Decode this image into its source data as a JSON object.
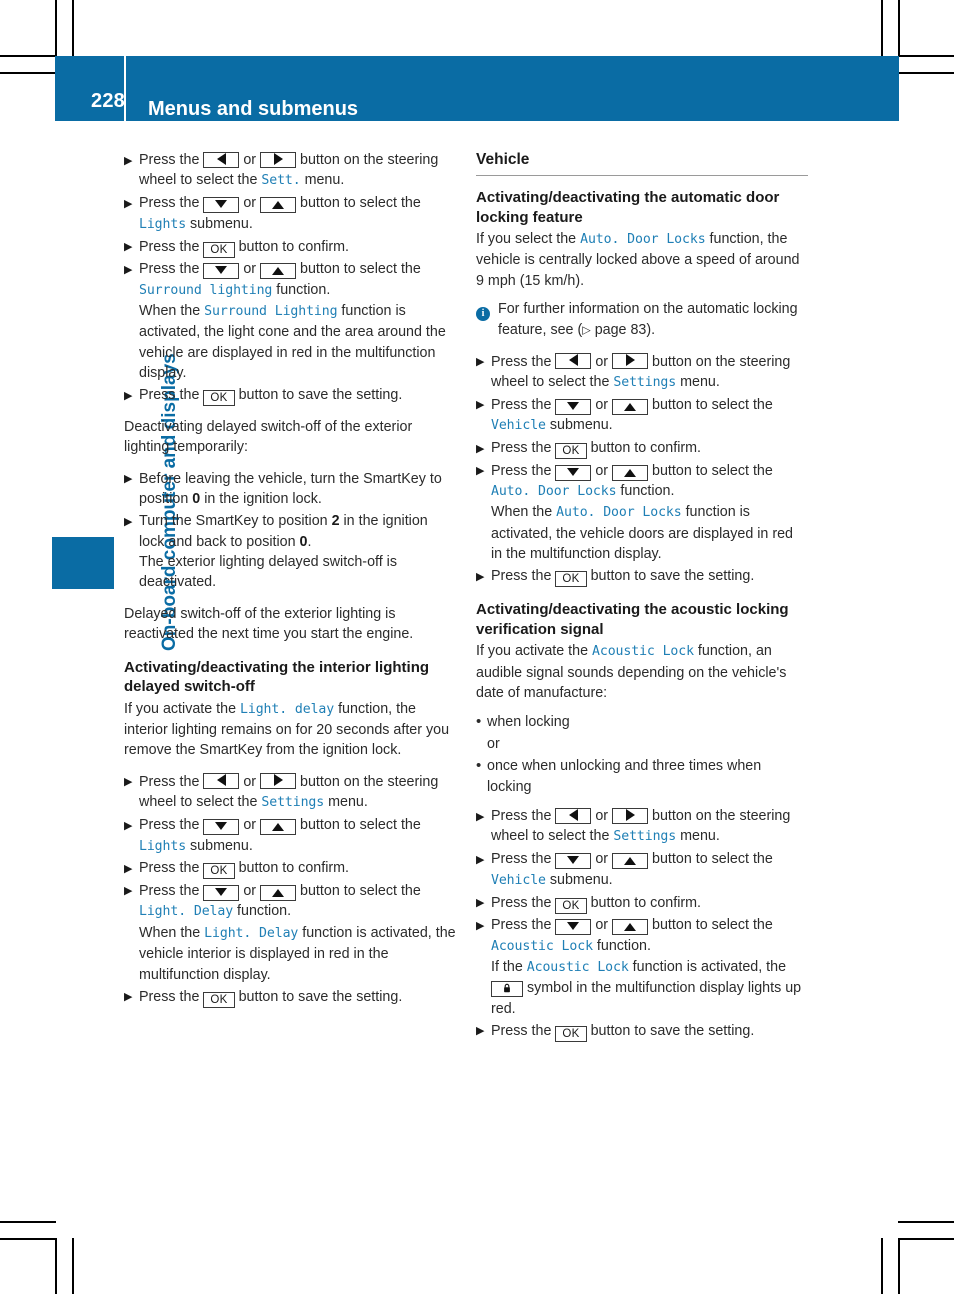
{
  "header": {
    "page_number": "228",
    "title": "Menus and submenus"
  },
  "sidebar": {
    "chapter_label": "On-board computer and displays"
  },
  "left_column": {
    "steps_surround": [
      {
        "id": "s1",
        "text_a": "Press the ",
        "key1": "left-arrow",
        "or": " or ",
        "key2": "right-arrow",
        "text_b": " button on the steering wheel to select the ",
        "mono": "Sett.",
        "text_c": " menu."
      },
      {
        "id": "s2",
        "text_a": "Press the ",
        "key1": "down-arrow",
        "or": " or ",
        "key2": "up-arrow",
        "text_b": " button to select the ",
        "mono": "Lights",
        "text_c": " submenu."
      },
      {
        "id": "s3",
        "text_a": "Press the ",
        "key1": "OK",
        "text_b": " button to confirm."
      },
      {
        "id": "s4",
        "text_a": "Press the ",
        "key1": "down-arrow",
        "or": " or ",
        "key2": "up-arrow",
        "text_b": " button to select the ",
        "mono": "Surround lighting",
        "text_c": " function.",
        "follow_a": "When the ",
        "follow_mono": "Surround Lighting",
        "follow_b": " function is activated, the light cone and the area around the vehicle are displayed in red in the multifunction display."
      },
      {
        "id": "s5",
        "text_a": "Press the ",
        "key1": "OK",
        "text_b": " button to save the setting."
      }
    ],
    "deactivating_intro": "Deactivating delayed switch-off of the exterior lighting temporarily:",
    "steps_deactivate": [
      {
        "id": "d1",
        "text_a": "Before leaving the vehicle, turn the SmartKey to position ",
        "bold": "0",
        "text_b": " in the ignition lock."
      },
      {
        "id": "d2",
        "text_a": "Turn the SmartKey to position ",
        "bold": "2",
        "text_b": " in the ignition lock and back to position ",
        "bold2": "0",
        "text_c": ".",
        "follow": "The exterior lighting delayed switch-off is deactivated."
      }
    ],
    "reactivate_note": "Delayed switch-off of the exterior lighting is reactivated the next time you start the engine.",
    "interior_heading": "Activating/deactivating the interior lighting delayed switch-off",
    "interior_intro_a": "If you activate the ",
    "interior_intro_mono": "Light. delay",
    "interior_intro_b": " function, the interior lighting remains on for 20 seconds after you remove the SmartKey from the ignition lock.",
    "steps_interior": [
      {
        "id": "i1",
        "text_a": "Press the ",
        "key1": "left-arrow",
        "or": " or ",
        "key2": "right-arrow",
        "text_b": " button on the steering wheel to select the ",
        "mono": "Settings",
        "text_c": " menu."
      },
      {
        "id": "i2",
        "text_a": "Press the ",
        "key1": "down-arrow",
        "or": " or ",
        "key2": "up-arrow",
        "text_b": " button to select the ",
        "mono": "Lights",
        "text_c": " submenu."
      },
      {
        "id": "i3",
        "text_a": "Press the ",
        "key1": "OK",
        "text_b": " button to confirm."
      },
      {
        "id": "i4",
        "text_a": "Press the ",
        "key1": "down-arrow",
        "or": " or ",
        "key2": "up-arrow",
        "text_b": " button to select the ",
        "mono": "Light. Delay",
        "text_c": " function.",
        "follow_a": "When the ",
        "follow_mono": "Light. Delay",
        "follow_b": " function is activated, the vehicle interior is displayed in red in the multifunction display."
      },
      {
        "id": "i5",
        "text_a": "Press the ",
        "key1": "OK",
        "text_b": " button to save the setting."
      }
    ]
  },
  "right_column": {
    "section_heading": "Vehicle",
    "auto_door_heading": "Activating/deactivating the automatic door locking feature",
    "auto_door_intro_a": "If you select the ",
    "auto_door_intro_mono": "Auto. Door Locks",
    "auto_door_intro_b": " function, the vehicle is centrally locked above a speed of around 9 mph (15 km/h).",
    "note_icon": "info-icon",
    "note_text_a": "For further information on the automatic locking feature, see (",
    "note_page_arrow": "▷",
    "note_text_b": " page 83).",
    "steps_auto_door": [
      {
        "id": "a1",
        "text_a": "Press the ",
        "key1": "left-arrow",
        "or": " or ",
        "key2": "right-arrow",
        "text_b": " button on the steering wheel to select the ",
        "mono": "Settings",
        "text_c": " menu."
      },
      {
        "id": "a2",
        "text_a": "Press the ",
        "key1": "down-arrow",
        "or": " or ",
        "key2": "up-arrow",
        "text_b": " button to select the ",
        "mono": "Vehicle",
        "text_c": " submenu."
      },
      {
        "id": "a3",
        "text_a": "Press the ",
        "key1": "OK",
        "text_b": " button to confirm."
      },
      {
        "id": "a4",
        "text_a": "Press the ",
        "key1": "down-arrow",
        "or": " or ",
        "key2": "up-arrow",
        "text_b": " button to select the ",
        "mono": "Auto. Door Locks",
        "text_c": " function.",
        "follow_a": "When the ",
        "follow_mono": "Auto. Door Locks",
        "follow_b": " function is activated, the vehicle doors are displayed in red in the multifunction display."
      },
      {
        "id": "a5",
        "text_a": "Press the ",
        "key1": "OK",
        "text_b": " button to save the setting."
      }
    ],
    "acoustic_heading": "Activating/deactivating the acoustic locking verification signal",
    "acoustic_intro_a": "If you activate the ",
    "acoustic_intro_mono": "Acoustic Lock",
    "acoustic_intro_b": " function, an audible signal sounds depending on the vehicle's date of manufacture:",
    "acoustic_bullets": [
      "when locking",
      "or",
      "once when unlocking and three times when locking"
    ],
    "steps_acoustic": [
      {
        "id": "c1",
        "text_a": "Press the ",
        "key1": "left-arrow",
        "or": " or ",
        "key2": "right-arrow",
        "text_b": " button on the steering wheel to select the ",
        "mono": "Settings",
        "text_c": " menu."
      },
      {
        "id": "c2",
        "text_a": "Press the ",
        "key1": "down-arrow",
        "or": " or ",
        "key2": "up-arrow",
        "text_b": " button to select the ",
        "mono": "Vehicle",
        "text_c": " submenu."
      },
      {
        "id": "c3",
        "text_a": "Press the ",
        "key1": "OK",
        "text_b": " button to confirm."
      },
      {
        "id": "c4",
        "text_a": "Press the ",
        "key1": "down-arrow",
        "or": " or ",
        "key2": "up-arrow",
        "text_b": " button to select the ",
        "mono": "Acoustic Lock",
        "text_c": " function.",
        "follow_a": "If the ",
        "follow_mono": "Acoustic Lock",
        "follow_b": " function is activated, the ",
        "follow_key": "padlock-symbol",
        "follow_c": " symbol in the multifunction display lights up red."
      },
      {
        "id": "c5",
        "text_a": "Press the ",
        "key1": "OK",
        "text_b": " button to save the setting."
      }
    ]
  },
  "keys": {
    "ok_label": "OK"
  },
  "colors": {
    "brand_blue": "#0a6ca4",
    "mono_blue": "#1f7fb5",
    "text": "#2b2b2b"
  }
}
